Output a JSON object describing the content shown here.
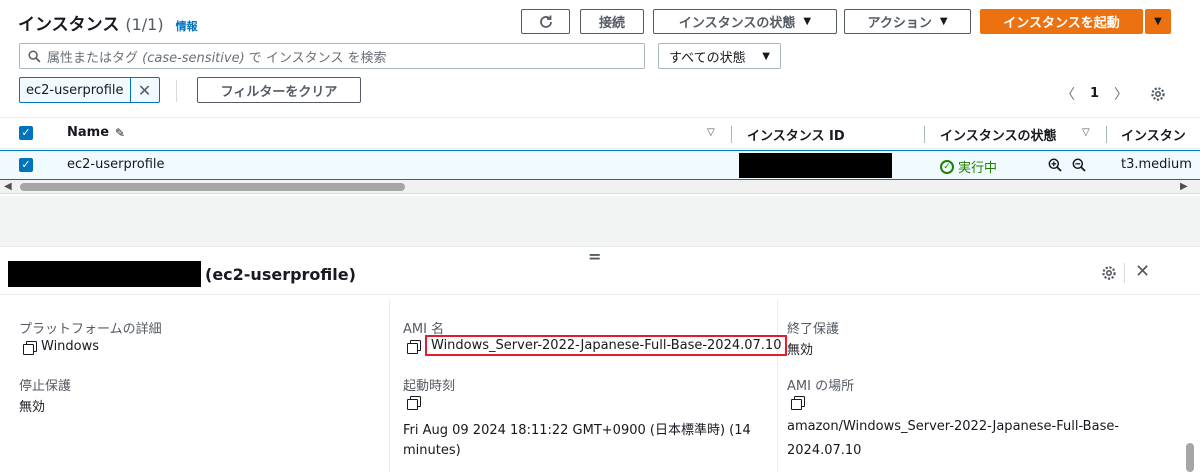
{
  "header": {
    "title": "インスタンス",
    "count": "(1/1)",
    "info_link": "情報"
  },
  "toolbar": {
    "refresh_icon": "refresh-icon",
    "connect_label": "接続",
    "instance_state_label": "インスタンスの状態",
    "actions_label": "アクション",
    "launch_label": "インスタンスを起動",
    "colors": {
      "primary": "#ec7211",
      "link": "#0073bb",
      "running": "#1d8102",
      "highlight": "#e01e2d"
    }
  },
  "search": {
    "prefix": "属性またはタグ ",
    "case_hint": "(case-sensitive)",
    "suffix": " で インスタンス を検索"
  },
  "state_filter": {
    "selected": "すべての状態"
  },
  "filter": {
    "token_label": "ec2-userprofile",
    "clear_label": "フィルターをクリア"
  },
  "pagination": {
    "current_page": "1"
  },
  "table": {
    "columns": {
      "name": "Name",
      "instance_id": "インスタンス ID",
      "instance_state": "インスタンスの状態",
      "instance_type": "インスタン"
    },
    "rows": [
      {
        "name": "ec2-userprofile",
        "state": "実行中",
        "type": "t3.medium"
      }
    ]
  },
  "detail": {
    "title_suffix": "(ec2-userprofile)",
    "fields": {
      "platform_label": "プラットフォームの詳細",
      "platform_value": "Windows",
      "stop_protection_label": "停止保護",
      "stop_protection_value": "無効",
      "ami_name_label": "AMI 名",
      "ami_name_value": "Windows_Server-2022-Japanese-Full-Base-2024.07.10",
      "launch_time_label": "起動時刻",
      "launch_time_line1": "Fri Aug 09 2024 18:11:22 GMT+0900 (日本標準時) (14",
      "launch_time_line2": "minutes)",
      "termination_label": "終了保護",
      "termination_value": "無効",
      "ami_location_label": "AMI の場所",
      "ami_location_line1": "amazon/Windows_Server-2022-Japanese-Full-Base-",
      "ami_location_line2": "2024.07.10"
    }
  }
}
